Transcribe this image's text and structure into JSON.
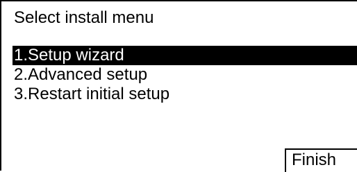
{
  "screen": {
    "title": "Select install menu"
  },
  "menu": {
    "items": [
      {
        "label": "1.Setup wizard",
        "selected": true
      },
      {
        "label": "2.Advanced setup",
        "selected": false
      },
      {
        "label": "3.Restart initial setup",
        "selected": false
      }
    ]
  },
  "footer": {
    "finish_label": "Finish"
  },
  "colors": {
    "background": "#ffffff",
    "foreground": "#000000",
    "selection_background": "#000000",
    "selection_foreground": "#ffffff"
  }
}
